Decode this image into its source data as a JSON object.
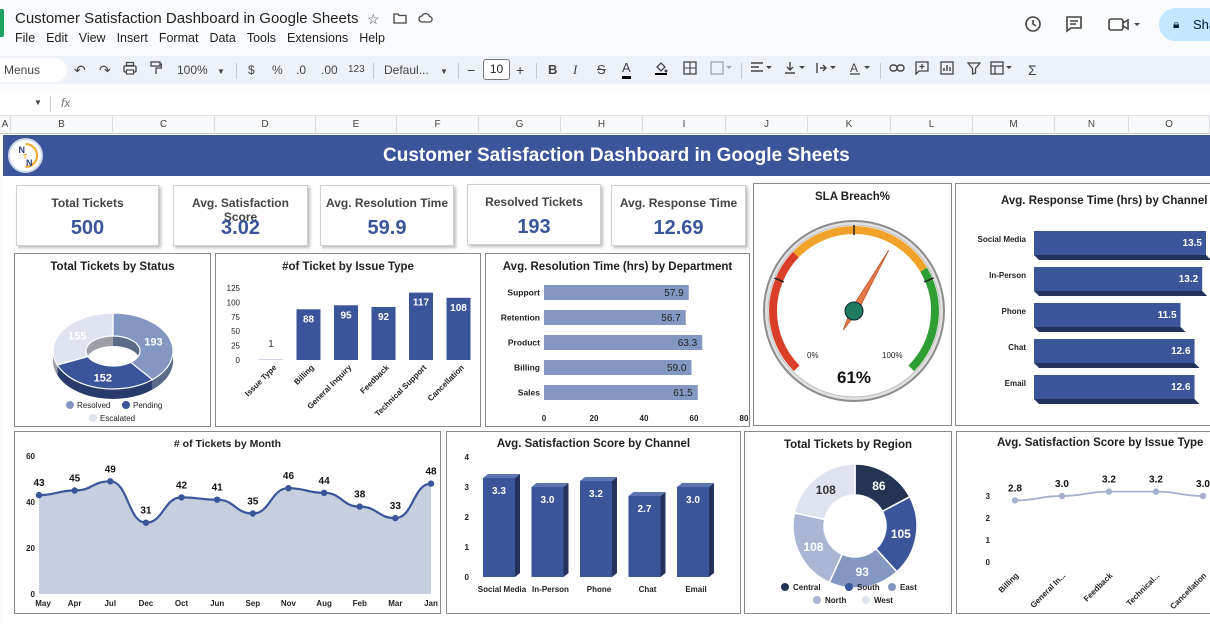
{
  "window": {
    "doc_title": "Customer Satisfaction Dashboard in Google Sheets",
    "menu": [
      "File",
      "Edit",
      "View",
      "Insert",
      "Format",
      "Data",
      "Tools",
      "Extensions",
      "Help"
    ],
    "share_label": "Sha"
  },
  "toolbar": {
    "menus_label": "Menus",
    "zoom": "100%",
    "currency": "$",
    "percent": "%",
    "dec_decrease": ".0",
    "dec_increase": ".00",
    "number_format": "123",
    "font": "Defaul...",
    "font_size": "10"
  },
  "formula_bar": {
    "fx": "fx"
  },
  "columns": [
    "A",
    "B",
    "C",
    "D",
    "E",
    "F",
    "G",
    "H",
    "I",
    "J",
    "K",
    "L",
    "M",
    "N",
    "O"
  ],
  "dashboard": {
    "title": "Customer Satisfaction Dashboard in Google Sheets",
    "logo_letters": [
      "N",
      "T",
      "N"
    ],
    "kpis": [
      {
        "label": "Total Tickets",
        "value": "500"
      },
      {
        "label": "Avg. Satisfaction Score",
        "value": "3.02"
      },
      {
        "label": "Avg. Resolution Time",
        "value": "59.9"
      },
      {
        "label": "Resolved Tickets",
        "value": "193"
      },
      {
        "label": "Avg. Response Time",
        "value": "12.69"
      }
    ]
  },
  "colors": {
    "dark_blue": "#3a559a",
    "mid_blue": "#8497c3",
    "light_blue": "#dfe3ef",
    "navy": "#253453",
    "area_fill": "#c6cee0",
    "gauge_red": "#d93f28",
    "gauge_orange": "#f0a22a",
    "gauge_green": "#2f9e35",
    "needle": "#e8784a",
    "hub": "#1e7b5f"
  },
  "chart_data": [
    {
      "id": "status",
      "type": "pie",
      "title": "Total Tickets by Status",
      "labels": [
        "Resolved",
        "Pending",
        "Escalated"
      ],
      "values": [
        193,
        152,
        155
      ],
      "legend": "bottom"
    },
    {
      "id": "issue",
      "type": "bar",
      "title": "#of Ticket by Issue Type",
      "categories": [
        "Issue Type",
        "Billing",
        "General Inquiry",
        "Feedback",
        "Technical Support",
        "Cancellation"
      ],
      "values": [
        1,
        88,
        95,
        92,
        117,
        108
      ],
      "yticks": [
        "125",
        "100",
        "75",
        "50",
        "25",
        "0"
      ],
      "ylim": [
        0,
        125
      ]
    },
    {
      "id": "resolution",
      "type": "bar",
      "orientation": "horizontal",
      "title": "Avg. Resolution Time (hrs) by Department",
      "categories": [
        "Support",
        "Retention",
        "Product",
        "Billing",
        "Sales"
      ],
      "values": [
        57.9,
        56.7,
        63.3,
        59.0,
        61.5
      ],
      "labels": [
        "57.9",
        "56.7",
        "63.3",
        "59.0",
        "61.5"
      ],
      "xticks": [
        "0",
        "20",
        "40",
        "60",
        "80"
      ],
      "xlim": [
        0,
        80
      ]
    },
    {
      "id": "sla",
      "type": "gauge",
      "title": "SLA Breach%",
      "value": 61,
      "value_label": "61%",
      "min_label": "0%",
      "max_label": "100%"
    },
    {
      "id": "response",
      "type": "bar",
      "orientation": "horizontal",
      "title": "Avg. Response Time (hrs) by Channel",
      "categories": [
        "Social Media",
        "In-Person",
        "Phone",
        "Chat",
        "Email"
      ],
      "values": [
        13.5,
        13.2,
        11.5,
        12.6,
        12.6
      ],
      "labels": [
        "13.5",
        "13.2",
        "11.5",
        "12.6",
        "12.6"
      ]
    },
    {
      "id": "month",
      "type": "area",
      "title": "# of Tickets by Month",
      "categories": [
        "May",
        "Jun",
        "Jul",
        "Aug",
        "Sep",
        "Oct",
        "Nov",
        "Dec",
        "Jan",
        "Feb",
        "Mar",
        "Apr",
        "May",
        "Jun"
      ],
      "values": [
        43,
        45,
        49,
        31,
        42,
        41,
        35,
        46,
        44,
        38,
        33,
        48
      ],
      "point_labels": [
        "43",
        "45",
        "49",
        "31",
        "42",
        "41",
        "35",
        "46",
        "44",
        "38",
        "33",
        "48"
      ],
      "xtick_labels": [
        "May",
        "Apr",
        "Jul",
        "Dec",
        "Oct",
        "Jun",
        "Sep",
        "Nov",
        "Aug",
        "Feb",
        "Mar",
        "Jan"
      ],
      "yticks": [
        "60",
        "40",
        "20",
        "0"
      ],
      "ylim": [
        0,
        60
      ]
    },
    {
      "id": "sat_channel",
      "type": "bar",
      "title": "Avg. Satisfaction Score by Channel",
      "categories": [
        "Social Media",
        "In-Person",
        "Phone",
        "Chat",
        "Email"
      ],
      "values": [
        3.3,
        3.0,
        3.2,
        2.7,
        3.0
      ],
      "labels": [
        "3.3",
        "3.0",
        "3.2",
        "2.7",
        "3.0"
      ],
      "yticks": [
        "4",
        "3",
        "2",
        "1",
        "0"
      ],
      "ylim": [
        0,
        4
      ]
    },
    {
      "id": "region",
      "type": "pie",
      "title": "Total Tickets by Region",
      "labels": [
        "Central",
        "South",
        "East",
        "North",
        "West"
      ],
      "values": [
        86,
        105,
        93,
        108,
        108
      ],
      "legend": "bottom"
    },
    {
      "id": "sat_issue",
      "type": "line",
      "title": "Avg. Satisfaction Score by Issue Type",
      "categories": [
        "Billing",
        "General In...",
        "Feedback",
        "Technical...",
        "Cancellation"
      ],
      "values": [
        2.8,
        3.0,
        3.2,
        3.2,
        3.0
      ],
      "labels": [
        "2.8",
        "3.0",
        "3.2",
        "3.2",
        "3.0"
      ],
      "yticks": [
        "3",
        "3",
        "2",
        "1",
        "0"
      ],
      "ylim": [
        0,
        4
      ]
    }
  ]
}
